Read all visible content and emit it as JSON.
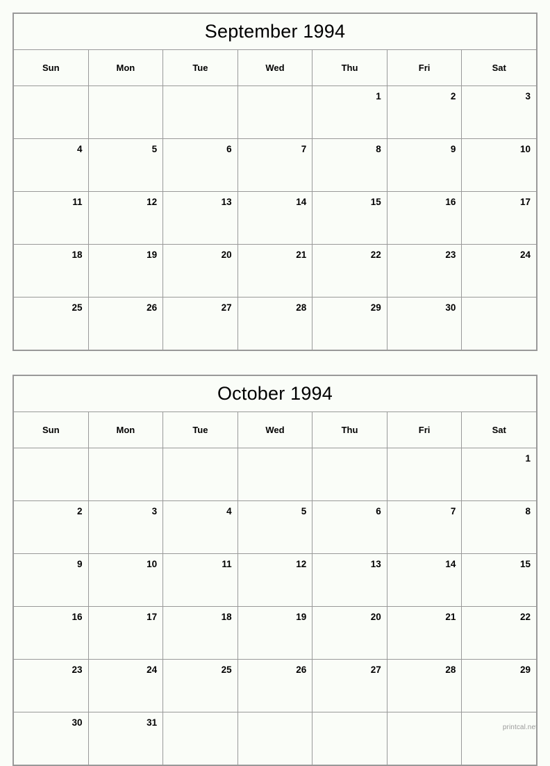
{
  "page": {
    "background_color": "#fafdf8",
    "border_color": "#999999",
    "text_color": "#000000"
  },
  "footer": {
    "label": "printcal.net",
    "color": "#9a9a9a"
  },
  "months": [
    {
      "title": "September 1994",
      "weekday_headers": [
        "Sun",
        "Mon",
        "Tue",
        "Wed",
        "Thu",
        "Fri",
        "Sat"
      ],
      "weeks": [
        [
          "",
          "",
          "",
          "",
          "1",
          "2",
          "3"
        ],
        [
          "4",
          "5",
          "6",
          "7",
          "8",
          "9",
          "10"
        ],
        [
          "11",
          "12",
          "13",
          "14",
          "15",
          "16",
          "17"
        ],
        [
          "18",
          "19",
          "20",
          "21",
          "22",
          "23",
          "24"
        ],
        [
          "25",
          "26",
          "27",
          "28",
          "29",
          "30",
          ""
        ]
      ]
    },
    {
      "title": "October 1994",
      "weekday_headers": [
        "Sun",
        "Mon",
        "Tue",
        "Wed",
        "Thu",
        "Fri",
        "Sat"
      ],
      "weeks": [
        [
          "",
          "",
          "",
          "",
          "",
          "",
          "1"
        ],
        [
          "2",
          "3",
          "4",
          "5",
          "6",
          "7",
          "8"
        ],
        [
          "9",
          "10",
          "11",
          "12",
          "13",
          "14",
          "15"
        ],
        [
          "16",
          "17",
          "18",
          "19",
          "20",
          "21",
          "22"
        ],
        [
          "23",
          "24",
          "25",
          "26",
          "27",
          "28",
          "29"
        ],
        [
          "30",
          "31",
          "",
          "",
          "",
          "",
          ""
        ]
      ]
    }
  ]
}
